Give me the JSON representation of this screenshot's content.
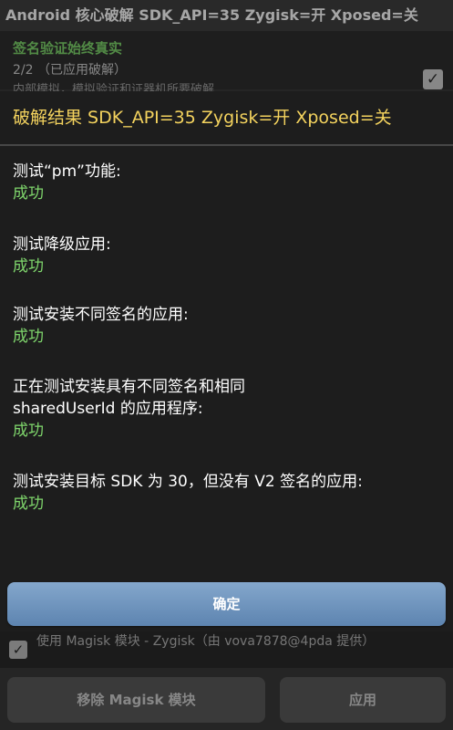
{
  "app": {
    "title": "Android 核心破解 SDK_API=35 Zygisk=开 Xposed=关",
    "pref_item": {
      "title": "签名验证始终真实",
      "summary": "2/2 （已应用破解）",
      "checked": true,
      "under_text": "内部模拟，模拟验证和证器机所要破解"
    },
    "bottom_option": {
      "label": "使用 Magisk 模块 - Zygisk（由 vova7878@4pda 提供）",
      "checked": true
    },
    "buttons": {
      "remove_module": "移除 Magisk 模块",
      "apply": "应用"
    }
  },
  "dialog": {
    "title": "破解结果 SDK_API=35 Zygisk=开 Xposed=关",
    "results": [
      {
        "question": "测试“pm”功能:",
        "result": "成功"
      },
      {
        "question": "测试降级应用:",
        "result": "成功"
      },
      {
        "question": "测试安装不同签名的应用:",
        "result": "成功"
      },
      {
        "question": "正在测试安装具有不同签名和相同 sharedUserId 的应用程序:",
        "result": "成功"
      },
      {
        "question": "测试安装目标 SDK 为 30，但没有 V2 签名的应用:",
        "result": "成功"
      }
    ],
    "ok_label": "确定"
  },
  "colors": {
    "accent_title": "#f4d35e",
    "success": "#7fd66c",
    "ok_button": "#6f95c0"
  }
}
